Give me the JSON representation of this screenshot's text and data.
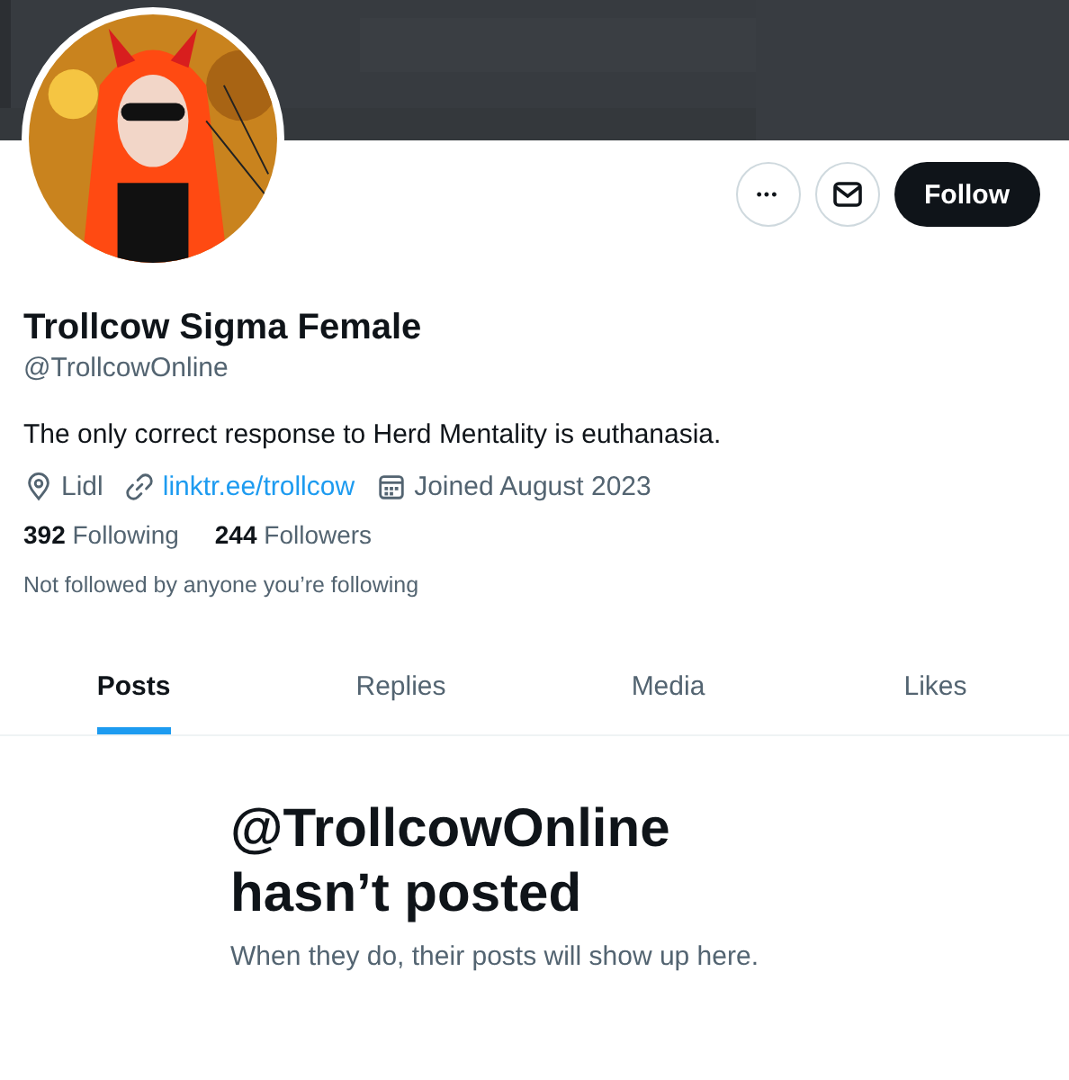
{
  "actions": {
    "more": "•••",
    "follow": "Follow"
  },
  "profile": {
    "name": "Trollcow Sigma Female",
    "handle": "@TrollcowOnline",
    "bio": "The only correct response to Herd Mentality is euthanasia.",
    "location": "Lidl",
    "link": "linktr.ee/trollcow",
    "joined": "Joined August 2023"
  },
  "stats": [
    {
      "count": "392",
      "label": "Following"
    },
    {
      "count": "244",
      "label": "Followers"
    }
  ],
  "followed_by": "Not followed by anyone you’re following",
  "tabs": [
    {
      "label": "Posts",
      "selected": true
    },
    {
      "label": "Replies",
      "selected": false
    },
    {
      "label": "Media",
      "selected": false
    },
    {
      "label": "Likes",
      "selected": false
    }
  ],
  "empty_state": {
    "title": "@TrollcowOnline hasn’t posted",
    "subtitle": "When they do, their posts will show up here."
  }
}
